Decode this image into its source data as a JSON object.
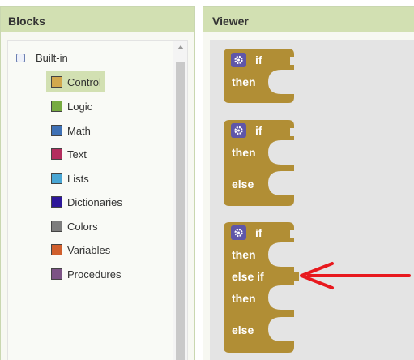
{
  "blocks_panel": {
    "title": "Blocks",
    "root_label": "Built-in",
    "categories": [
      {
        "label": "Control",
        "color": "#d2a84e",
        "selected": true
      },
      {
        "label": "Logic",
        "color": "#77ab41"
      },
      {
        "label": "Math",
        "color": "#3f71b5"
      },
      {
        "label": "Text",
        "color": "#b32d5e"
      },
      {
        "label": "Lists",
        "color": "#49a6d4"
      },
      {
        "label": "Dictionaries",
        "color": "#2d1799"
      },
      {
        "label": "Colors",
        "color": "#7d7d7d"
      },
      {
        "label": "Variables",
        "color": "#d05f2d"
      },
      {
        "label": "Procedures",
        "color": "#7c5385"
      }
    ]
  },
  "viewer": {
    "title": "Viewer",
    "block_color": "#b18e35",
    "blocks": [
      {
        "lines": [
          "if",
          "then"
        ]
      },
      {
        "lines": [
          "if",
          "then",
          "else"
        ]
      },
      {
        "lines": [
          "if",
          "then",
          "else if",
          "then",
          "else"
        ]
      }
    ],
    "arrow_color": "#e8191e"
  }
}
